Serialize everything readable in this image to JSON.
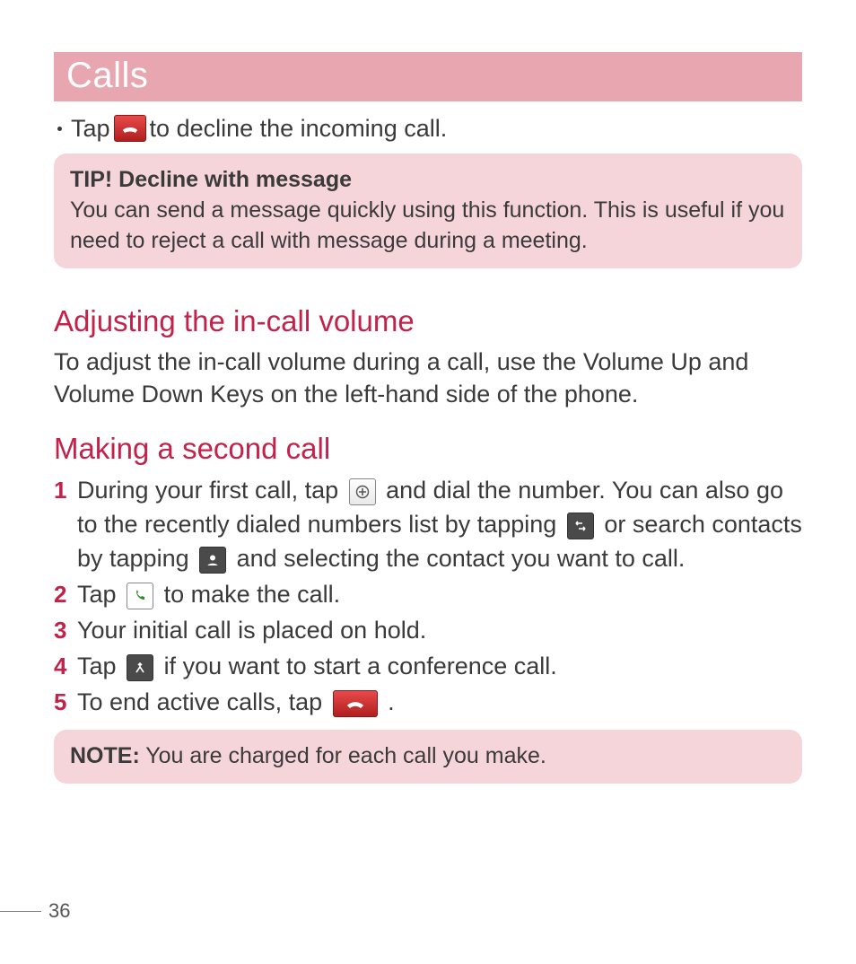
{
  "title": "Calls",
  "decline_line": {
    "pre": "Tap ",
    "post": " to decline the incoming call."
  },
  "tip": {
    "title": "TIP! Decline with message",
    "body": "You can send a message quickly using this function. This is useful if you need to reject a call with message during a meeting."
  },
  "section1": {
    "heading": "Adjusting the in-call volume",
    "body": "To adjust the in-call volume during a call, use the Volume Up and Volume Down Keys on the left-hand side of the phone."
  },
  "section2": {
    "heading": "Making a second call",
    "steps": {
      "s1_num": "1",
      "s1a": "During your first call, tap ",
      "s1b": " and dial the number. You can also go to the recently dialed numbers list by tapping ",
      "s1c": " or search contacts by tapping ",
      "s1d": " and selecting the contact you want to call.",
      "s2_num": "2",
      "s2a": "Tap ",
      "s2b": " to make the call.",
      "s3_num": "3",
      "s3": "Your initial call is placed on hold.",
      "s4_num": "4",
      "s4a": "Tap ",
      "s4b": " if you want to start a conference call.",
      "s5_num": "5",
      "s5a": "To end active calls, tap ",
      "s5b": "."
    }
  },
  "note": {
    "label": "NOTE:",
    "body": " You are charged for each call you make."
  },
  "page_number": "36"
}
